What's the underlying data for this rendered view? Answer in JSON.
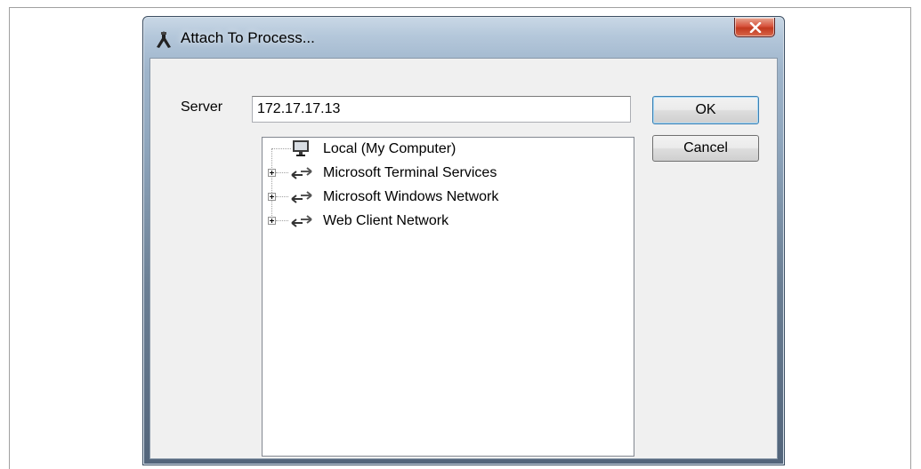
{
  "window": {
    "title": "Attach To Process...",
    "icon": "attach-process-icon",
    "close_icon": "close-icon"
  },
  "server": {
    "label": "Server",
    "value": "172.17.17.13"
  },
  "buttons": {
    "ok_label": "OK",
    "cancel_label": "Cancel"
  },
  "tree": {
    "items": [
      {
        "label": "Local (My Computer)",
        "icon": "computer-icon",
        "expandable": false
      },
      {
        "label": "Microsoft Terminal Services",
        "icon": "network-arrows-icon",
        "expandable": true
      },
      {
        "label": "Microsoft Windows Network",
        "icon": "network-arrows-icon",
        "expandable": true
      },
      {
        "label": "Web Client Network",
        "icon": "network-arrows-icon",
        "expandable": true
      }
    ]
  },
  "colors": {
    "close_button": "#c2391f",
    "title_glass": "#b4c7da",
    "client_bg": "#f0f0f0"
  }
}
